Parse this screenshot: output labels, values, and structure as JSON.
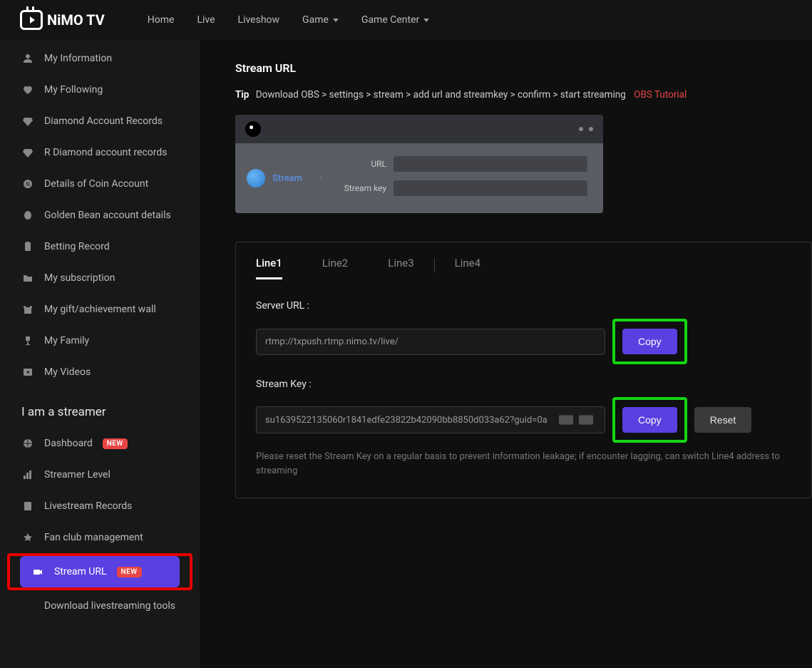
{
  "brand": "NiMO TV",
  "nav": [
    {
      "label": "Home",
      "dropdown": false
    },
    {
      "label": "Live",
      "dropdown": false
    },
    {
      "label": "Liveshow",
      "dropdown": false
    },
    {
      "label": "Game",
      "dropdown": true
    },
    {
      "label": "Game Center",
      "dropdown": true
    }
  ],
  "sidebar_top": [
    {
      "label": "My Information",
      "icon": "user"
    },
    {
      "label": "My Following",
      "icon": "heart"
    },
    {
      "label": "Diamond Account Records",
      "icon": "diamond"
    },
    {
      "label": "R Diamond account records",
      "icon": "diamond"
    },
    {
      "label": "Details of Coin Account",
      "icon": "coin"
    },
    {
      "label": "Golden Bean account details",
      "icon": "bean"
    },
    {
      "label": "Betting Record",
      "icon": "clipboard"
    },
    {
      "label": "My subscription",
      "icon": "folder"
    },
    {
      "label": "My gift/achievement wall",
      "icon": "gift"
    },
    {
      "label": "My Family",
      "icon": "trophy"
    },
    {
      "label": "My Videos",
      "icon": "play"
    }
  ],
  "section_title": "I am a streamer",
  "sidebar_bottom": [
    {
      "label": "Dashboard",
      "icon": "grid",
      "badge": "NEW",
      "active": false,
      "highlight": false
    },
    {
      "label": "Streamer Level",
      "icon": "bars",
      "badge": null,
      "active": false,
      "highlight": false
    },
    {
      "label": "Livestream Records",
      "icon": "doc",
      "badge": null,
      "active": false,
      "highlight": false
    },
    {
      "label": "Fan club management",
      "icon": "star",
      "badge": null,
      "active": false,
      "highlight": false
    },
    {
      "label": "Stream URL",
      "icon": "camera",
      "badge": "NEW",
      "active": true,
      "highlight": true
    },
    {
      "label": "Download livestreaming tools",
      "icon": "download",
      "badge": null,
      "active": false,
      "highlight": false
    }
  ],
  "page": {
    "title": "Stream URL",
    "tip_label": "Tip",
    "tip_text": "Download OBS > settings > stream > add url and streamkey > confirm > start streaming",
    "tip_link": "OBS Tutorial",
    "obs": {
      "stream_label": "Stream",
      "url_label": "URL",
      "key_label": "Stream key"
    },
    "tabs": [
      "Line1",
      "Line2",
      "Line3",
      "Line4"
    ],
    "active_tab": 0,
    "server": {
      "label": "Server URL :",
      "value": "rtmp://txpush.rtmp.nimo.tv/live/",
      "copy": "Copy"
    },
    "key": {
      "label": "Stream Key :",
      "value": "su1639522135060r1841edfe23822b42090bb8850d033a62?guid=0a",
      "copy": "Copy",
      "reset": "Reset"
    },
    "note": "Please reset the Stream Key on a regular basis to prevent information leakage; if encounter lagging, can switch Line4 address to streaming"
  }
}
